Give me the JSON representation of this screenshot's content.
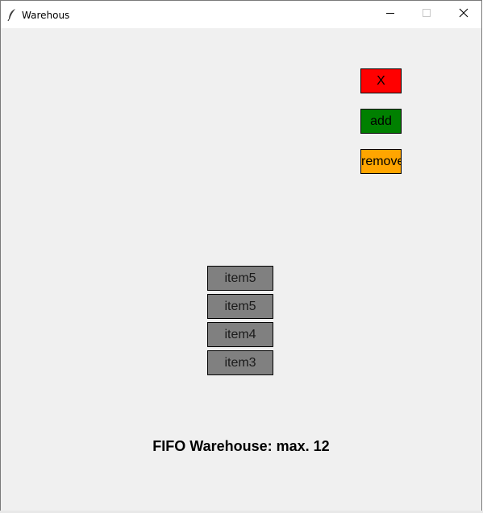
{
  "window": {
    "title": "Warehous"
  },
  "buttons": {
    "close_label": "X",
    "add_label": "add",
    "remove_label": "remove"
  },
  "colors": {
    "close_button": "#ff0000",
    "add_button": "#008000",
    "remove_button": "#ffa500",
    "item_background": "#808080"
  },
  "items": [
    "item5",
    "item5",
    "item4",
    "item3"
  ],
  "footer": {
    "text": "FIFO Warehouse: max. 12"
  }
}
